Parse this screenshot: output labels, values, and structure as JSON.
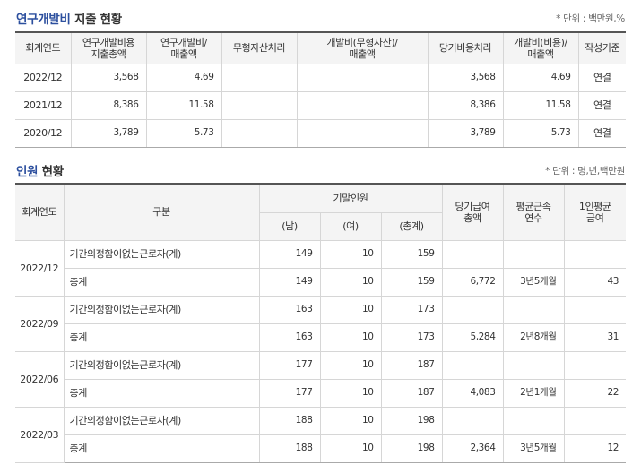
{
  "rnd": {
    "title_accent": "연구개발비",
    "title_rest": " 지출 현황",
    "unit": "* 단위 : 백만원,%",
    "headers": [
      "회계연도",
      "연구개발비용\n지출총액",
      "연구개발비/\n매출액",
      "무형자산처리",
      "개발비(무형자산)/\n매출액",
      "당기비용처리",
      "개발비(비용)/\n매출액",
      "작성기준"
    ],
    "rows": [
      {
        "year": "2022/12",
        "total": "3,568",
        "ratio": "4.69",
        "intangible": "",
        "intangible_ratio": "",
        "expense": "3,568",
        "expense_ratio": "4.69",
        "basis": "연결"
      },
      {
        "year": "2021/12",
        "total": "8,386",
        "ratio": "11.58",
        "intangible": "",
        "intangible_ratio": "",
        "expense": "8,386",
        "expense_ratio": "11.58",
        "basis": "연결"
      },
      {
        "year": "2020/12",
        "total": "3,789",
        "ratio": "5.73",
        "intangible": "",
        "intangible_ratio": "",
        "expense": "3,789",
        "expense_ratio": "5.73",
        "basis": "연결"
      }
    ]
  },
  "staff": {
    "title_accent": "인원",
    "title_rest": " 현황",
    "unit": "* 단위 : 명,년,백만원",
    "headers": {
      "year": "회계연도",
      "category": "구분",
      "headcount": "기말인원",
      "male": "(남)",
      "female": "(여)",
      "total": "(총계)",
      "pay_total": "당기급여\n총액",
      "tenure": "평균근속\n연수",
      "pay_avg": "1인평균\n급여"
    },
    "groups": [
      {
        "year": "2022/12",
        "rows": [
          {
            "category": "기간의정함이없는근로자(계)",
            "male": "149",
            "female": "10",
            "total": "159",
            "pay_total": "",
            "tenure": "",
            "pay_avg": ""
          },
          {
            "category": "총계",
            "male": "149",
            "female": "10",
            "total": "159",
            "pay_total": "6,772",
            "tenure": "3년5개월",
            "pay_avg": "43"
          }
        ]
      },
      {
        "year": "2022/09",
        "rows": [
          {
            "category": "기간의정함이없는근로자(계)",
            "male": "163",
            "female": "10",
            "total": "173",
            "pay_total": "",
            "tenure": "",
            "pay_avg": ""
          },
          {
            "category": "총계",
            "male": "163",
            "female": "10",
            "total": "173",
            "pay_total": "5,284",
            "tenure": "2년8개월",
            "pay_avg": "31"
          }
        ]
      },
      {
        "year": "2022/06",
        "rows": [
          {
            "category": "기간의정함이없는근로자(계)",
            "male": "177",
            "female": "10",
            "total": "187",
            "pay_total": "",
            "tenure": "",
            "pay_avg": ""
          },
          {
            "category": "총계",
            "male": "177",
            "female": "10",
            "total": "187",
            "pay_total": "4,083",
            "tenure": "2년1개월",
            "pay_avg": "22"
          }
        ]
      },
      {
        "year": "2022/03",
        "rows": [
          {
            "category": "기간의정함이없는근로자(계)",
            "male": "188",
            "female": "10",
            "total": "198",
            "pay_total": "",
            "tenure": "",
            "pay_avg": ""
          },
          {
            "category": "총계",
            "male": "188",
            "female": "10",
            "total": "198",
            "pay_total": "2,364",
            "tenure": "3년5개월",
            "pay_avg": "12"
          }
        ]
      }
    ]
  }
}
